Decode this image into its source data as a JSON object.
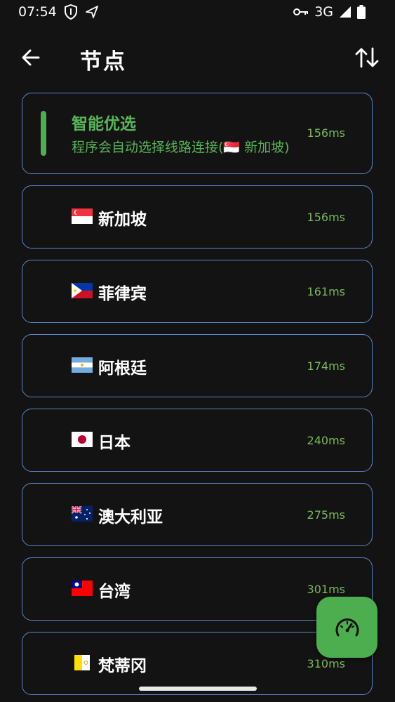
{
  "status_bar": {
    "time": "07:54",
    "network": "3G"
  },
  "app_bar": {
    "title": "节点"
  },
  "smart_select": {
    "title": "智能优选",
    "subtitle": "程序会自动选择线路连接(🇸🇬 新加坡)",
    "latency": "156ms"
  },
  "nodes": [
    {
      "flag": "SG",
      "name": "新加坡",
      "latency": "156ms"
    },
    {
      "flag": "PH",
      "name": "菲律宾",
      "latency": "161ms"
    },
    {
      "flag": "AR",
      "name": "阿根廷",
      "latency": "174ms"
    },
    {
      "flag": "JP",
      "name": "日本",
      "latency": "240ms"
    },
    {
      "flag": "AU",
      "name": "澳大利亚",
      "latency": "275ms"
    },
    {
      "flag": "TW",
      "name": "台湾",
      "latency": "301ms"
    },
    {
      "flag": "VA",
      "name": "梵蒂冈",
      "latency": "310ms"
    }
  ],
  "colors": {
    "background": "#131313",
    "card_border": "#5a86c8",
    "accent_green": "#4cae4f",
    "latency_green": "#7ab85a"
  },
  "icons": {
    "back": "arrow-left-icon",
    "sort": "sort-arrows-icon",
    "fab": "speedometer-icon"
  }
}
